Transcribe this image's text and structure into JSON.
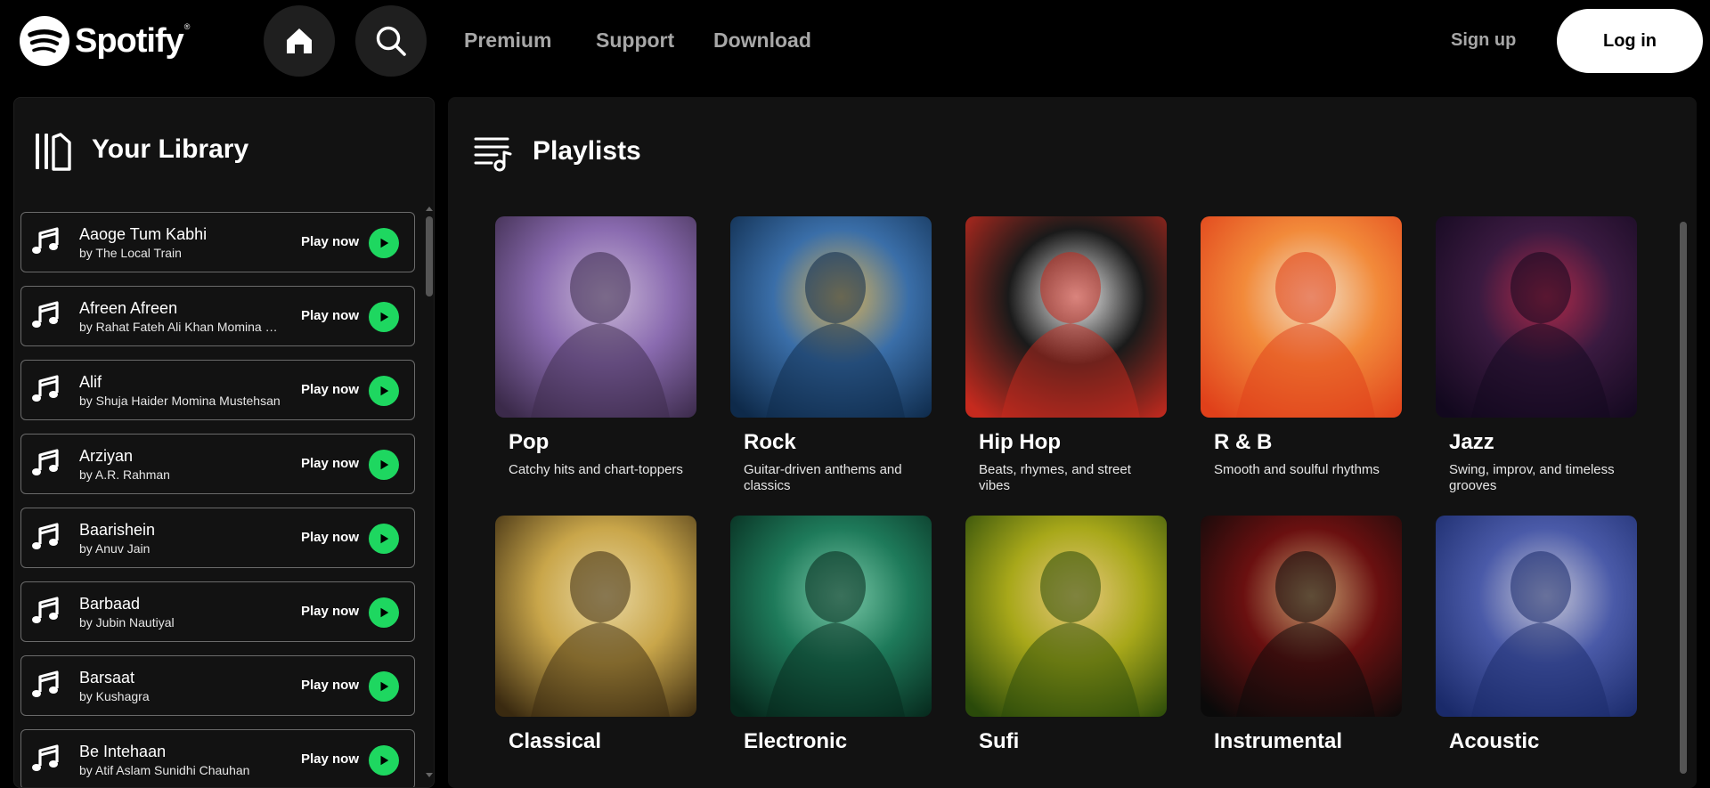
{
  "nav": {
    "brand": "Spotify",
    "trademark": "®",
    "links": [
      "Premium",
      "Support",
      "Download"
    ],
    "signup": "Sign up",
    "login": "Log in"
  },
  "library": {
    "title": "Your Library",
    "play_label": "Play now",
    "songs": [
      {
        "title": "Aaoge Tum Kabhi",
        "artist": "by The Local Train"
      },
      {
        "title": "Afreen Afreen",
        "artist": "by Rahat Fateh Ali Khan Momina Mustehsan"
      },
      {
        "title": "Alif",
        "artist": "by Shuja Haider Momina Mustehsan"
      },
      {
        "title": "Arziyan",
        "artist": "by A.R. Rahman"
      },
      {
        "title": "Baarishein",
        "artist": "by Anuv Jain"
      },
      {
        "title": "Barbaad",
        "artist": "by Jubin Nautiyal"
      },
      {
        "title": "Barsaat",
        "artist": "by Kushagra"
      },
      {
        "title": "Be Intehaan",
        "artist": "by Atif Aslam Sunidhi Chauhan"
      }
    ]
  },
  "playlists": {
    "title": "Playlists",
    "items": [
      {
        "name": "Pop",
        "desc": "Catchy hits and chart-toppers",
        "colors": [
          "#3b2a4a",
          "#8a6bb0",
          "#c9b7d6"
        ]
      },
      {
        "name": "Rock",
        "desc": "Guitar-driven anthems and classics",
        "colors": [
          "#0e2a4a",
          "#3a6ea8",
          "#d8b25a"
        ]
      },
      {
        "name": "Hip Hop",
        "desc": "Beats, rhymes, and street vibes",
        "colors": [
          "#c62a1e",
          "#1a1a1a",
          "#f2f2f2"
        ]
      },
      {
        "name": "R & B",
        "desc": "Smooth and soulful rhythms",
        "colors": [
          "#e0401a",
          "#f28a3a",
          "#f3e0c8"
        ]
      },
      {
        "name": "Jazz",
        "desc": "Swing, improv, and timeless grooves",
        "colors": [
          "#12081e",
          "#3a1a40",
          "#b02a4a"
        ]
      },
      {
        "name": "Classical",
        "desc": "",
        "colors": [
          "#3a2a10",
          "#c9a64a",
          "#e8d6a0"
        ]
      },
      {
        "name": "Electronic",
        "desc": "",
        "colors": [
          "#06281c",
          "#1e7a5a",
          "#7ac9a8"
        ]
      },
      {
        "name": "Sufi",
        "desc": "",
        "colors": [
          "#2a4a0a",
          "#a8a81a",
          "#e8c880"
        ]
      },
      {
        "name": "Instrumental",
        "desc": "",
        "colors": [
          "#0a0a0a",
          "#6a1010",
          "#c8a070"
        ]
      },
      {
        "name": "Acoustic",
        "desc": "",
        "colors": [
          "#1a2a6a",
          "#4a5aa8",
          "#c8c8d8"
        ]
      }
    ]
  },
  "colors": {
    "accent": "#1ed760",
    "panel": "#121212",
    "muted": "#a7a7a7"
  }
}
